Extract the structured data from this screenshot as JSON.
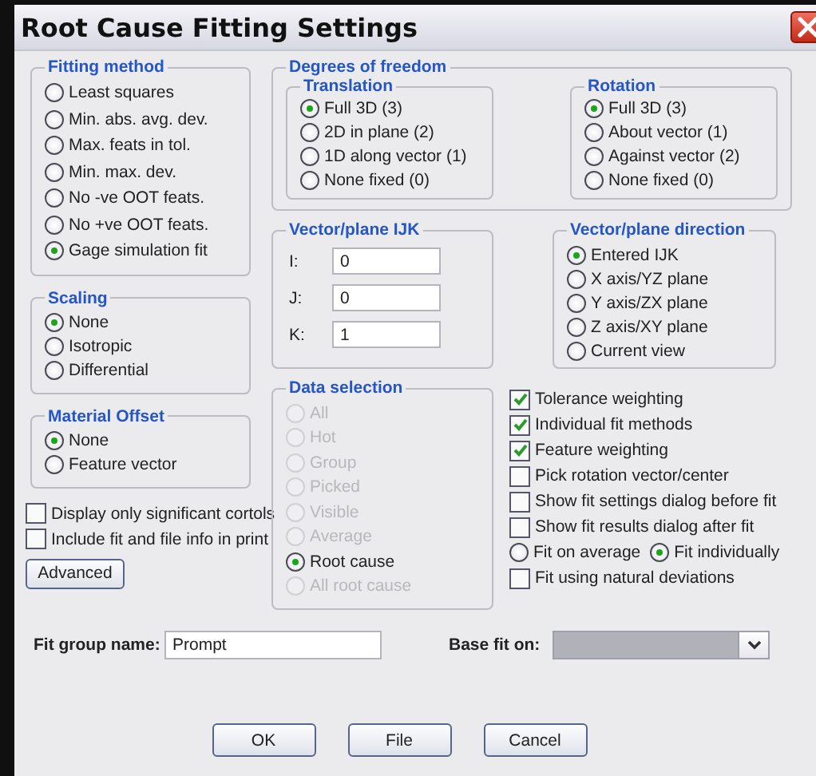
{
  "window": {
    "title": "Root Cause Fitting Settings"
  },
  "fitting_method": {
    "title": "Fitting method",
    "options": [
      {
        "label": "Least squares",
        "selected": false
      },
      {
        "label": "Min. abs. avg. dev.",
        "selected": false
      },
      {
        "label": "Max. feats in tol.",
        "selected": false
      },
      {
        "label": "Min. max. dev.",
        "selected": false
      },
      {
        "label": "No -ve OOT feats.",
        "selected": false
      },
      {
        "label": "No +ve OOT feats.",
        "selected": false
      },
      {
        "label": "Gage simulation fit",
        "selected": true
      }
    ]
  },
  "scaling": {
    "title": "Scaling",
    "options": [
      {
        "label": "None",
        "selected": true
      },
      {
        "label": "Isotropic",
        "selected": false
      },
      {
        "label": "Differential",
        "selected": false
      }
    ]
  },
  "material_offset": {
    "title": "Material Offset",
    "options": [
      {
        "label": "None",
        "selected": true
      },
      {
        "label": "Feature vector",
        "selected": false
      }
    ]
  },
  "left_checkboxes": [
    {
      "label": "Display only significant cortols",
      "checked": false
    },
    {
      "label": "Include fit and file info in print",
      "checked": false
    }
  ],
  "advanced_button": "Advanced",
  "degrees_of_freedom": {
    "title": "Degrees of freedom",
    "translation": {
      "title": "Translation",
      "options": [
        {
          "label": "Full 3D (3)",
          "selected": true
        },
        {
          "label": "2D in plane (2)",
          "selected": false
        },
        {
          "label": "1D along vector (1)",
          "selected": false
        },
        {
          "label": "None fixed (0)",
          "selected": false
        }
      ]
    },
    "rotation": {
      "title": "Rotation",
      "options": [
        {
          "label": "Full 3D (3)",
          "selected": true
        },
        {
          "label": "About vector (1)",
          "selected": false
        },
        {
          "label": "Against vector (2)",
          "selected": false
        },
        {
          "label": "None fixed (0)",
          "selected": false
        }
      ]
    }
  },
  "vector_ijk": {
    "title": "Vector/plane IJK",
    "fields": [
      {
        "label": "I:",
        "value": "0"
      },
      {
        "label": "J:",
        "value": "0"
      },
      {
        "label": "K:",
        "value": "1"
      }
    ]
  },
  "vector_direction": {
    "title": "Vector/plane direction",
    "options": [
      {
        "label": "Entered IJK",
        "selected": true
      },
      {
        "label": "X axis/YZ plane",
        "selected": false
      },
      {
        "label": "Y axis/ZX plane",
        "selected": false
      },
      {
        "label": "Z axis/XY plane",
        "selected": false
      },
      {
        "label": "Current view",
        "selected": false
      }
    ]
  },
  "data_selection": {
    "title": "Data selection",
    "options": [
      {
        "label": "All",
        "selected": false,
        "disabled": true
      },
      {
        "label": "Hot",
        "selected": false,
        "disabled": true
      },
      {
        "label": "Group",
        "selected": false,
        "disabled": true
      },
      {
        "label": "Picked",
        "selected": false,
        "disabled": true
      },
      {
        "label": "Visible",
        "selected": false,
        "disabled": true
      },
      {
        "label": "Average",
        "selected": false,
        "disabled": true
      },
      {
        "label": "Root cause",
        "selected": true,
        "disabled": false
      },
      {
        "label": "All root cause",
        "selected": false,
        "disabled": true
      }
    ]
  },
  "options": [
    {
      "kind": "checkbox",
      "label": "Tolerance weighting",
      "checked": true
    },
    {
      "kind": "checkbox",
      "label": "Individual fit methods",
      "checked": true
    },
    {
      "kind": "checkbox",
      "label": "Feature weighting",
      "checked": true
    },
    {
      "kind": "checkbox",
      "label": "Pick rotation vector/center",
      "checked": false
    },
    {
      "kind": "checkbox",
      "label": "Show fit settings dialog before fit",
      "checked": false
    },
    {
      "kind": "checkbox",
      "label": "Show fit results dialog after fit",
      "checked": false
    },
    {
      "kind": "radio_row",
      "choices": [
        {
          "label": "Fit on average",
          "selected": false
        },
        {
          "label": "Fit individually",
          "selected": true
        }
      ]
    },
    {
      "kind": "checkbox",
      "label": "Fit using natural deviations",
      "checked": false
    }
  ],
  "fit_group_name": {
    "label": "Fit group name:",
    "value": "Prompt"
  },
  "base_fit_on": {
    "label": "Base fit on:",
    "disabled": true
  },
  "buttons": [
    "OK",
    "File",
    "Cancel"
  ]
}
